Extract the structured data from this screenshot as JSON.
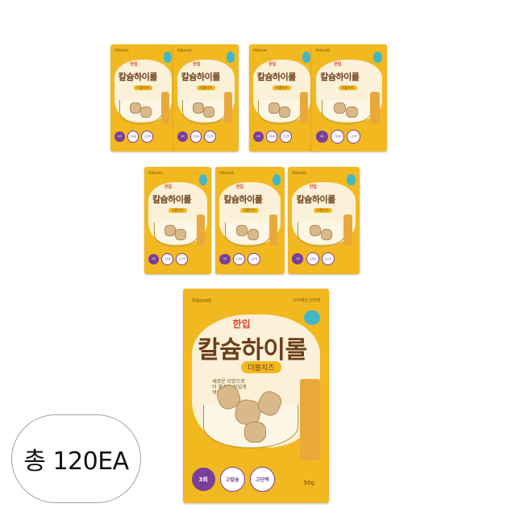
{
  "product": {
    "brand": "ifdonet",
    "prefix": "한입",
    "name": "칼슘하이롤",
    "flavor": "더블치즈",
    "note": "새로운 모양으로\n더 즐겁고 맛있게\n먹어요",
    "top_note": "아이배냇 안전해",
    "badges": [
      "3회",
      "고칼슘",
      "고단백"
    ],
    "weight": "50g"
  },
  "total_label": "총 120EA",
  "colors": {
    "package": "#f2b820",
    "window": "#fbf1d8",
    "accent_red": "#e0402e",
    "title_brown": "#6b3e1a",
    "badge_purple": "#7a3f9a"
  }
}
